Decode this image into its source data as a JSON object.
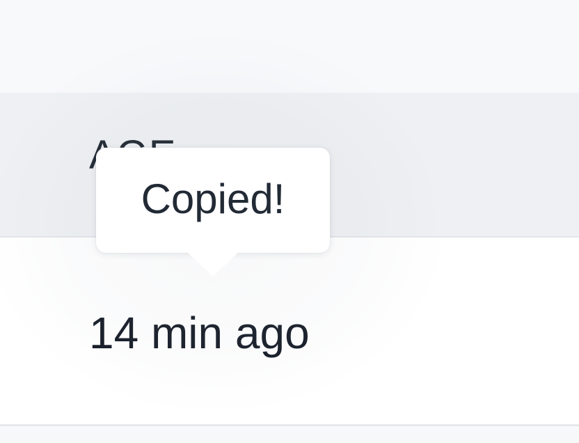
{
  "table": {
    "header": {
      "column_label": "AGE"
    },
    "rows": [
      {
        "age": "14 min ago"
      }
    ]
  },
  "tooltip": {
    "text": "Copied!"
  }
}
